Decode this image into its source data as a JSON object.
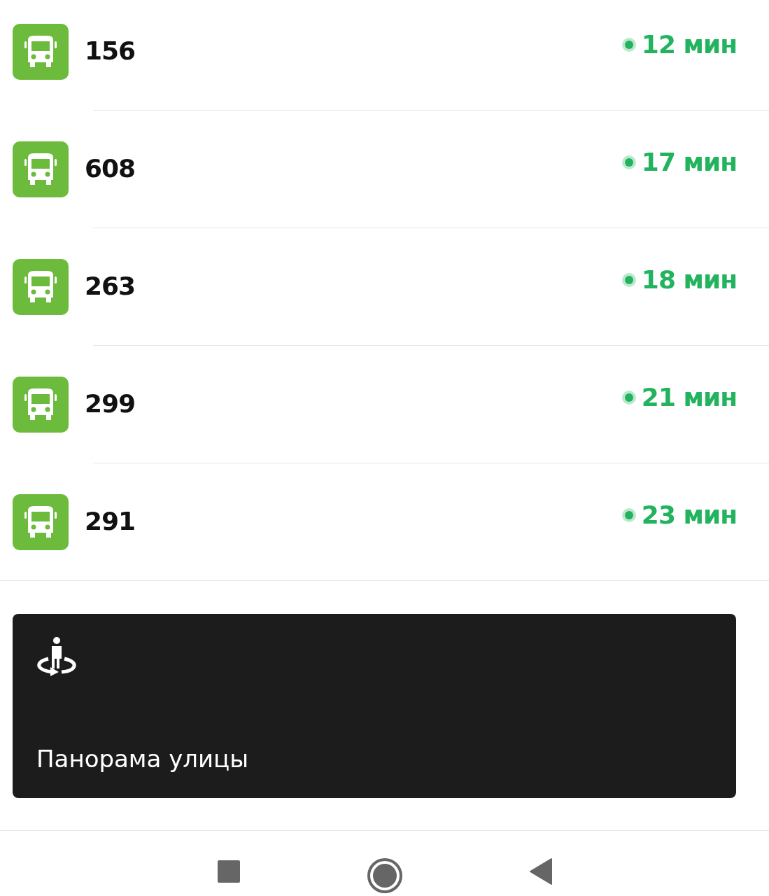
{
  "routes": [
    {
      "number": "156",
      "arrival": "12 мин",
      "realtime": true
    },
    {
      "number": "608",
      "arrival": "17 мин",
      "realtime": true
    },
    {
      "number": "263",
      "arrival": "18 мин",
      "realtime": true
    },
    {
      "number": "299",
      "arrival": "21 мин",
      "realtime": true
    },
    {
      "number": "291",
      "arrival": "23 мин",
      "realtime": true
    }
  ],
  "panorama_card": {
    "title": "Панорама улицы"
  }
}
